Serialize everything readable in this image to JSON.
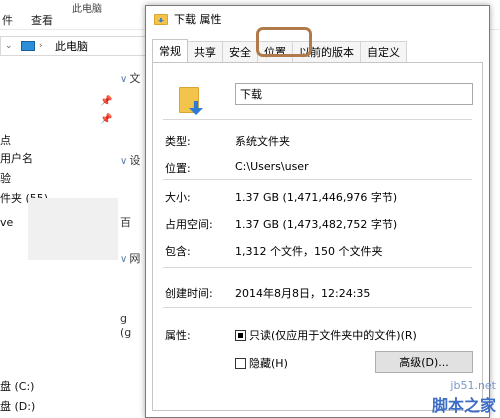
{
  "explorer": {
    "menu": [
      "件",
      "查看"
    ],
    "title_fragment": "此电脑",
    "address_crumb": "此电脑",
    "left_items": [
      {
        "label": "点"
      },
      {
        "label": "用户名"
      },
      {
        "label": "验"
      },
      {
        "label": "件夹 (55)"
      },
      {
        "label": "ve"
      },
      {
        "label": "盘 (C:)"
      },
      {
        "label": "盘 (D:)"
      }
    ],
    "mid_items": [
      {
        "label": "文"
      },
      {
        "label": "设"
      },
      {
        "label": "百"
      },
      {
        "label": "网"
      },
      {
        "label": "g"
      },
      {
        "label": "(g"
      }
    ]
  },
  "dialog": {
    "title": "下载 属性",
    "tabs": [
      "常规",
      "共享",
      "安全",
      "位置",
      "以前的版本",
      "自定义"
    ],
    "active_tab": "常规",
    "highlighted_tab": "位置",
    "name_value": "下载",
    "rows": [
      {
        "label": "类型:",
        "value": "系统文件夹"
      },
      {
        "label": "位置:",
        "value": "C:\\Users\\user"
      },
      {
        "label": "大小:",
        "value": "1.37 GB (1,471,446,976 字节)"
      },
      {
        "label": "占用空间:",
        "value": "1.37 GB (1,473,482,752 字节)"
      },
      {
        "label": "包含:",
        "value": "1,312 个文件，150 个文件夹"
      },
      {
        "label": "创建时间:",
        "value": "2014年8月8日，12:24:35"
      },
      {
        "label": "属性:",
        "value": ""
      }
    ],
    "readonly_label": "只读(仅应用于文件夹中的文件)(R)",
    "readonly_checked": true,
    "hidden_label": "隐藏(H)",
    "hidden_checked": false,
    "advanced_label": "高级(D)..."
  },
  "watermark": {
    "site": "jb51.net",
    "brand": "脚本之家"
  }
}
